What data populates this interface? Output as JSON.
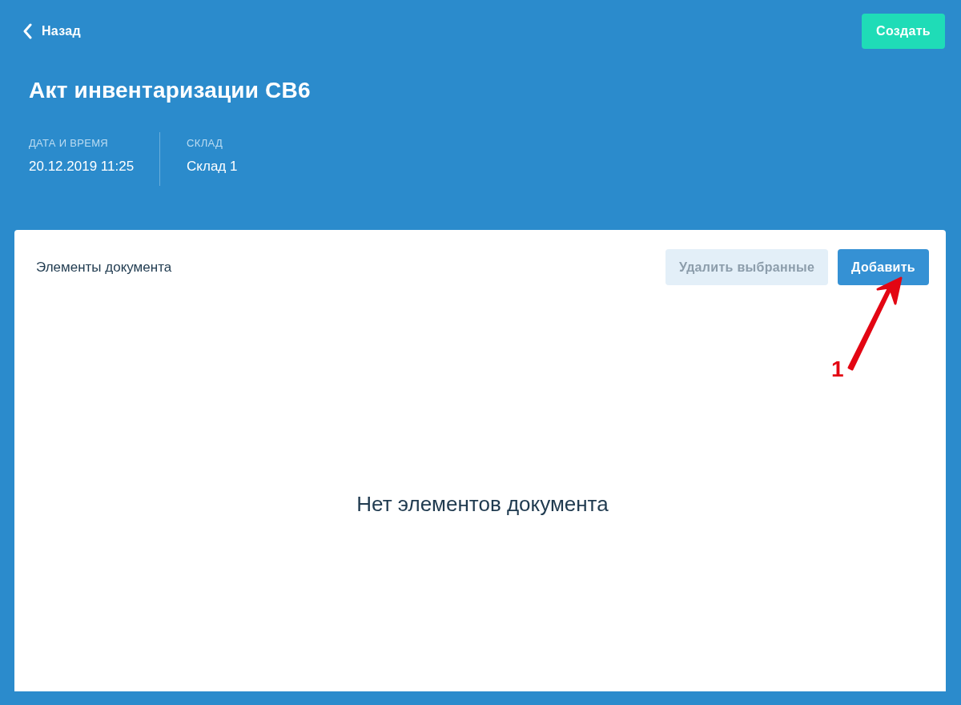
{
  "header": {
    "back_link": "Назад",
    "create_button": "Создать",
    "title": "Акт инвентаризации СВ6",
    "meta": [
      {
        "label": "ДАТА И ВРЕМЯ",
        "value": "20.12.2019 11:25"
      },
      {
        "label": "СКЛАД",
        "value": "Склад 1"
      }
    ]
  },
  "card": {
    "title": "Элементы документа",
    "buttons": [
      {
        "label": "Удалить выбранные",
        "disabled": true
      },
      {
        "label": "Добавить",
        "disabled": false
      }
    ],
    "empty_message": "Нет элементов документа"
  },
  "annotation": {
    "label": "1"
  }
}
